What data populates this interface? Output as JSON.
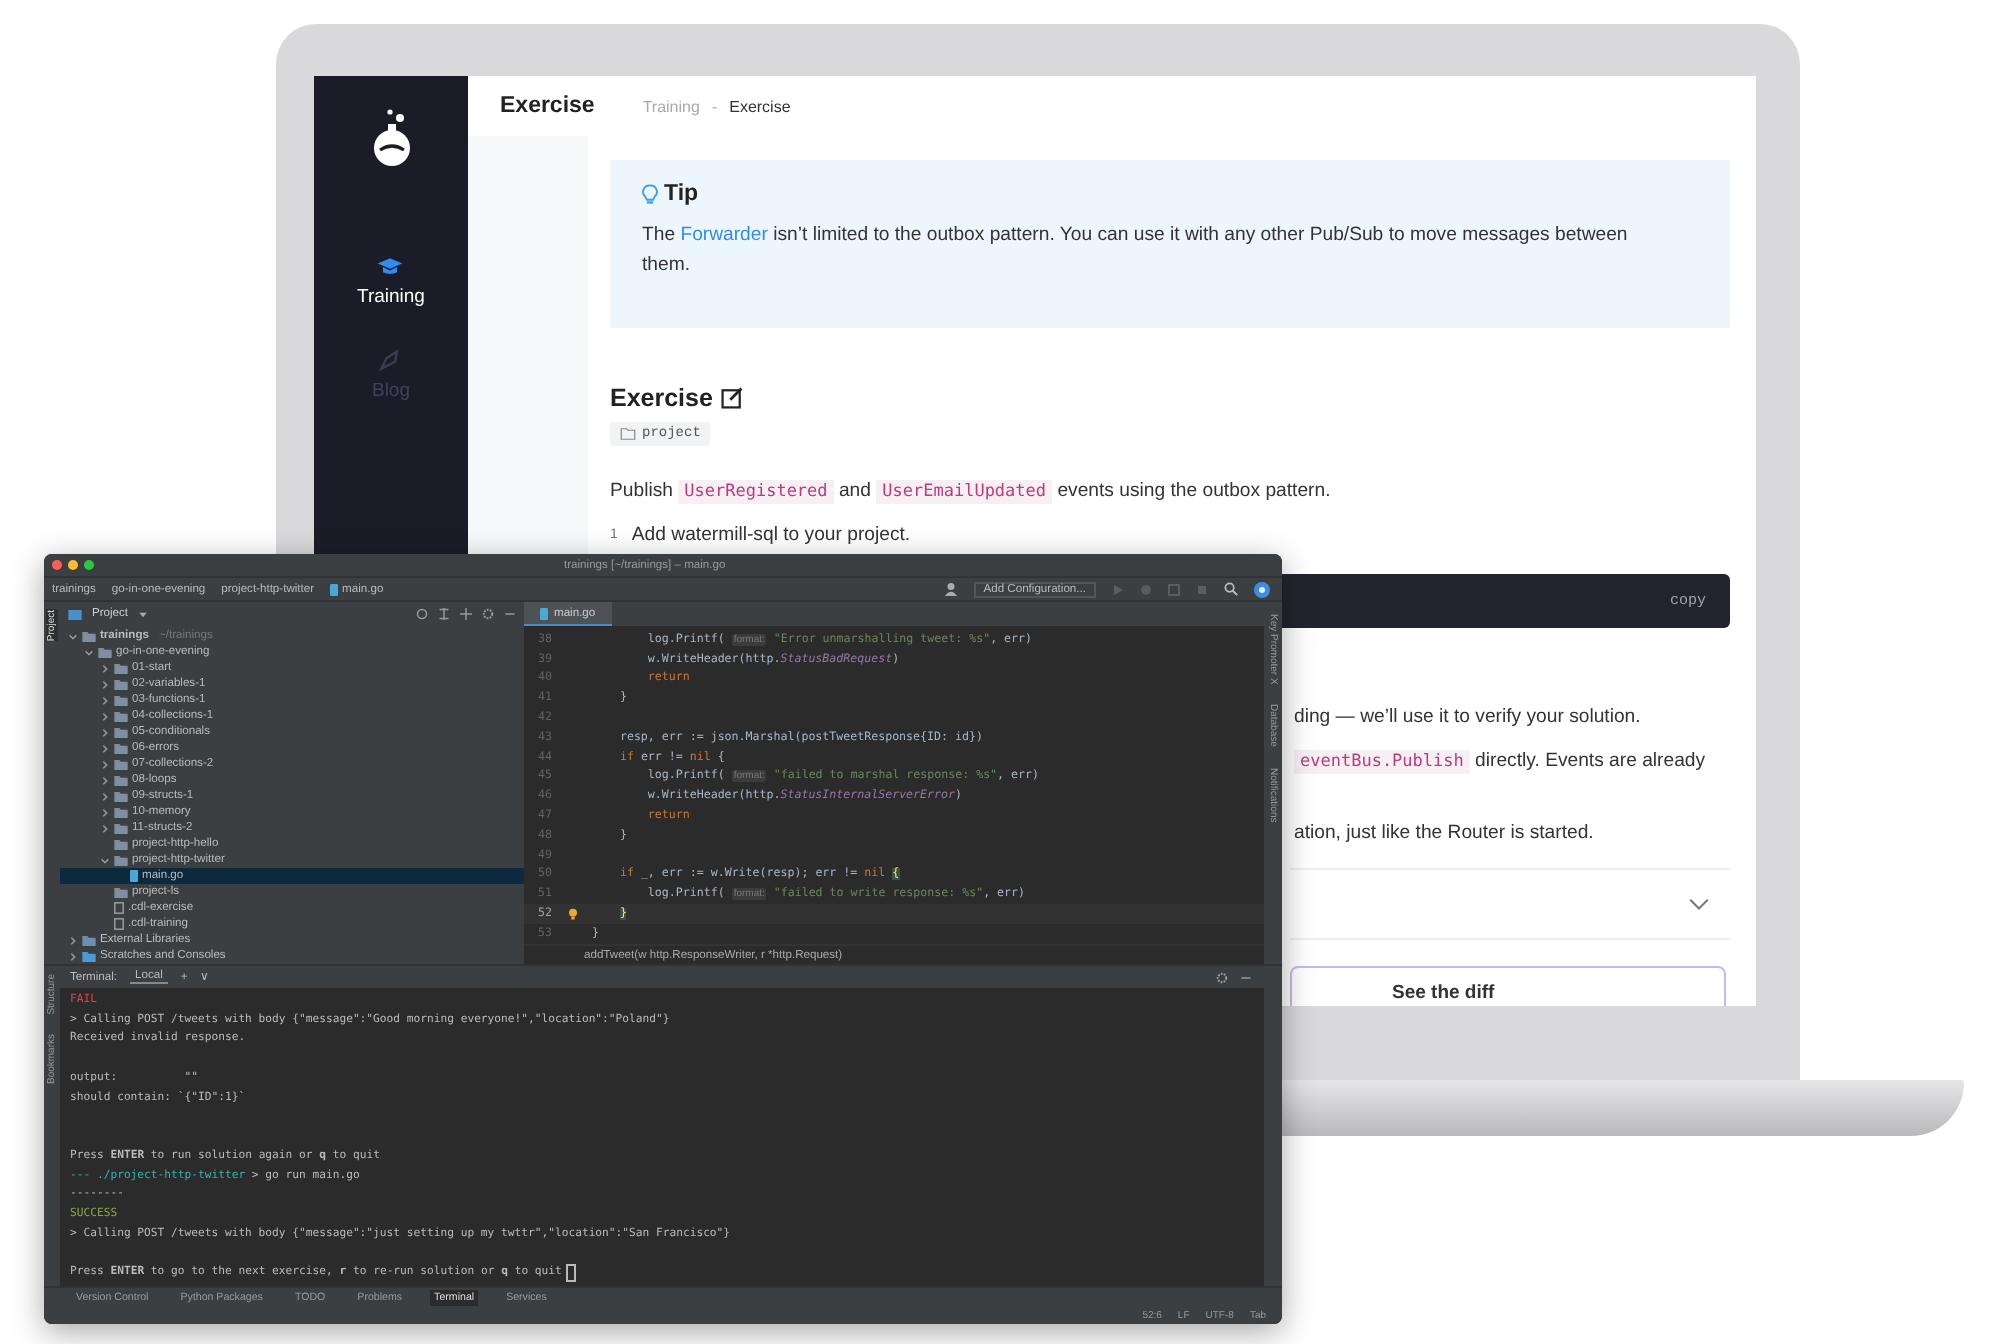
{
  "web": {
    "sidebar": {
      "items": [
        {
          "label": "Training",
          "selected": true
        },
        {
          "label": "Blog",
          "selected": false
        }
      ]
    },
    "header": {
      "title": "Exercise",
      "breadcrumb": [
        "Training",
        "Exercise"
      ],
      "separator": "-"
    },
    "tip": {
      "title": "Tip",
      "parts": [
        {
          "kind": "text",
          "t": "The "
        },
        {
          "kind": "link",
          "t": "Forwarder"
        },
        {
          "kind": "text",
          "t": " isn’t limited to the outbox pattern. You can use it with any other Pub/Sub to move messages between them."
        }
      ]
    },
    "exercise": {
      "title": "Exercise",
      "tag": "project",
      "intro": [
        {
          "kind": "text",
          "t": "Publish "
        },
        {
          "kind": "code",
          "t": "UserRegistered"
        },
        {
          "kind": "text",
          "t": " and "
        },
        {
          "kind": "code",
          "t": "UserEmailUpdated"
        },
        {
          "kind": "text",
          "t": " events using the outbox pattern."
        }
      ],
      "step": {
        "number": "1",
        "text": "Add watermill-sql to your project."
      },
      "copy": "copy"
    },
    "partial_lines": [
      [
        {
          "kind": "text",
          "t": "ding — we’ll use it to verify your solution."
        }
      ],
      [
        {
          "kind": "code",
          "t": "eventBus.Publish"
        },
        {
          "kind": "text",
          "t": " directly. Events are already"
        }
      ],
      [
        {
          "kind": "text",
          "t": "ation, just like the Router is started."
        }
      ]
    ],
    "diff_button": "See the diff"
  },
  "ide": {
    "title": "trainings [~/trainings] – main.go",
    "nav": [
      "trainings",
      "go-in-one-evening",
      "project-http-twitter",
      "main.go"
    ],
    "run_config": "Add Configuration...",
    "left_strip_top": [
      "Project"
    ],
    "left_strip_bottom": [
      "Bookmarks",
      "Structure"
    ],
    "right_strip": [
      "Key Promoter X",
      "Database",
      "Notifications"
    ],
    "project": {
      "title": "Project",
      "tree": [
        {
          "label": "trainings",
          "note": "~/trainings",
          "kind": "folder",
          "expanded": true,
          "selected": false,
          "children": [
            {
              "label": "go-in-one-evening",
              "kind": "folder",
              "expanded": true,
              "selected": false,
              "children": [
                {
                  "label": "01-start",
                  "kind": "folder",
                  "expanded": false,
                  "selected": false
                },
                {
                  "label": "02-variables-1",
                  "kind": "folder",
                  "expanded": false,
                  "selected": false
                },
                {
                  "label": "03-functions-1",
                  "kind": "folder",
                  "expanded": false,
                  "selected": false
                },
                {
                  "label": "04-collections-1",
                  "kind": "folder",
                  "expanded": false,
                  "selected": false
                },
                {
                  "label": "05-conditionals",
                  "kind": "folder",
                  "expanded": false,
                  "selected": false
                },
                {
                  "label": "06-errors",
                  "kind": "folder",
                  "expanded": false,
                  "selected": false
                },
                {
                  "label": "07-collections-2",
                  "kind": "folder",
                  "expanded": false,
                  "selected": false
                },
                {
                  "label": "08-loops",
                  "kind": "folder",
                  "expanded": false,
                  "selected": false
                },
                {
                  "label": "09-structs-1",
                  "kind": "folder",
                  "expanded": false,
                  "selected": false
                },
                {
                  "label": "10-memory",
                  "kind": "folder",
                  "expanded": false,
                  "selected": false
                },
                {
                  "label": "11-structs-2",
                  "kind": "folder",
                  "expanded": false,
                  "selected": false
                },
                {
                  "label": "project-http-hello",
                  "kind": "folder",
                  "selected": false
                },
                {
                  "label": "project-http-twitter",
                  "kind": "folder",
                  "expanded": true,
                  "selected": false,
                  "children": [
                    {
                      "label": "main.go",
                      "kind": "gofile",
                      "selected": true
                    }
                  ]
                },
                {
                  "label": "project-ls",
                  "kind": "folder",
                  "selected": false
                },
                {
                  "label": ".cdl-exercise",
                  "kind": "file",
                  "selected": false
                },
                {
                  "label": ".cdl-training",
                  "kind": "file",
                  "selected": false
                }
              ]
            }
          ]
        },
        {
          "label": "External Libraries",
          "kind": "library",
          "expanded": false,
          "selected": false
        },
        {
          "label": "Scratches and Consoles",
          "kind": "scratches",
          "expanded": false,
          "selected": false
        }
      ]
    },
    "editor": {
      "tab": "main.go",
      "breadcrumb": "addTweet(w http.ResponseWriter, r *http.Request)",
      "lines": [
        {
          "number": "38",
          "current": false,
          "tokens": [
            {
              "kind": "plain",
              "t": "        log.Printf( "
            },
            {
              "kind": "hint",
              "t": "format:"
            },
            {
              "kind": "str",
              "t": " \"Error unmarshalling tweet: %s\""
            },
            {
              "kind": "plain",
              "t": ", err)"
            }
          ]
        },
        {
          "number": "39",
          "current": false,
          "tokens": [
            {
              "kind": "plain",
              "t": "        w.WriteHeader(http."
            },
            {
              "kind": "const",
              "t": "StatusBadRequest"
            },
            {
              "kind": "plain",
              "t": ")"
            }
          ]
        },
        {
          "number": "40",
          "current": false,
          "tokens": [
            {
              "kind": "kw",
              "t": "        return"
            }
          ]
        },
        {
          "number": "41",
          "current": false,
          "tokens": [
            {
              "kind": "plain",
              "t": "    }"
            }
          ]
        },
        {
          "number": "42",
          "current": false
        },
        {
          "number": "43",
          "current": false,
          "tokens": [
            {
              "kind": "plain",
              "t": "    resp, err := json.Marshal(postTweetResponse{ID: id})"
            }
          ]
        },
        {
          "number": "44",
          "current": false,
          "tokens": [
            {
              "kind": "kw",
              "t": "    if"
            },
            {
              "kind": "plain",
              "t": " err != "
            },
            {
              "kind": "kw",
              "t": "nil"
            },
            {
              "kind": "plain",
              "t": " {"
            }
          ]
        },
        {
          "number": "45",
          "current": false,
          "tokens": [
            {
              "kind": "plain",
              "t": "        log.Printf( "
            },
            {
              "kind": "hint",
              "t": "format:"
            },
            {
              "kind": "str",
              "t": " \"failed to marshal response: %s\""
            },
            {
              "kind": "plain",
              "t": ", err)"
            }
          ]
        },
        {
          "number": "46",
          "current": false,
          "tokens": [
            {
              "kind": "plain",
              "t": "        w.WriteHeader(http."
            },
            {
              "kind": "const",
              "t": "StatusInternalServerError"
            },
            {
              "kind": "plain",
              "t": ")"
            }
          ]
        },
        {
          "number": "47",
          "current": false,
          "tokens": [
            {
              "kind": "kw",
              "t": "        return"
            }
          ]
        },
        {
          "number": "48",
          "current": false,
          "tokens": [
            {
              "kind": "plain",
              "t": "    }"
            }
          ]
        },
        {
          "number": "49",
          "current": false
        },
        {
          "number": "50",
          "current": false,
          "tokens": [
            {
              "kind": "kw",
              "t": "    if"
            },
            {
              "kind": "plain",
              "t": " _, err := w.Write(resp); err != "
            },
            {
              "kind": "kw",
              "t": "nil"
            },
            {
              "kind": "match",
              "t": " {"
            }
          ]
        },
        {
          "number": "51",
          "current": false,
          "tokens": [
            {
              "kind": "plain",
              "t": "        log.Printf( "
            },
            {
              "kind": "hint",
              "t": "format:"
            },
            {
              "kind": "str",
              "t": " \"failed to write response: %s\""
            },
            {
              "kind": "plain",
              "t": ", err)"
            }
          ]
        },
        {
          "number": "52",
          "current": true,
          "tokens": [
            {
              "kind": "match",
              "t": "    }"
            }
          ]
        },
        {
          "number": "53",
          "current": false,
          "tokens": [
            {
              "kind": "plain",
              "t": "}"
            }
          ]
        }
      ]
    },
    "terminal": {
      "title": "Terminal:",
      "tab": "Local",
      "add": "+",
      "more": "∨",
      "lines": [
        {
          "kind": "fail",
          "t": "FAIL"
        },
        {
          "kind": "text",
          "t": "> Calling POST /tweets with body {\"message\":\"Good morning everyone!\",\"location\":\"Poland\"}"
        },
        {
          "kind": "text",
          "t": "Received invalid response."
        },
        {
          "kind": "blank"
        },
        {
          "kind": "text",
          "t": "output:          \"\""
        },
        {
          "kind": "text",
          "t": "should contain: `{\"ID\":1}`"
        },
        {
          "kind": "blank"
        },
        {
          "kind": "blank"
        },
        {
          "kind": "text",
          "t": "Press **ENTER** to run solution again or **q** to quit"
        },
        {
          "kind": "prompt",
          "path": "--- ./project-http-twitter",
          "t": " > go run main.go"
        },
        {
          "kind": "text",
          "t": "--------"
        },
        {
          "kind": "success",
          "t": "SUCCESS"
        },
        {
          "kind": "text",
          "t": "> Calling POST /tweets with body {\"message\":\"just setting up my twttr\",\"location\":\"San Francisco\"}"
        },
        {
          "kind": "blank"
        },
        {
          "kind": "text",
          "t": "Press **ENTER** to go to the next exercise, **r** to re-run solution or **q** to quit",
          "cursor": true
        }
      ]
    },
    "tool_tabs": [
      {
        "label": "Version Control",
        "selected": false
      },
      {
        "label": "Python Packages",
        "selected": false
      },
      {
        "label": "TODO",
        "selected": false
      },
      {
        "label": "Problems",
        "selected": false
      },
      {
        "label": "Terminal",
        "selected": true
      },
      {
        "label": "Services",
        "selected": false
      }
    ],
    "status": [
      "52:6",
      "LF",
      "UTF-8",
      "Tab"
    ]
  }
}
